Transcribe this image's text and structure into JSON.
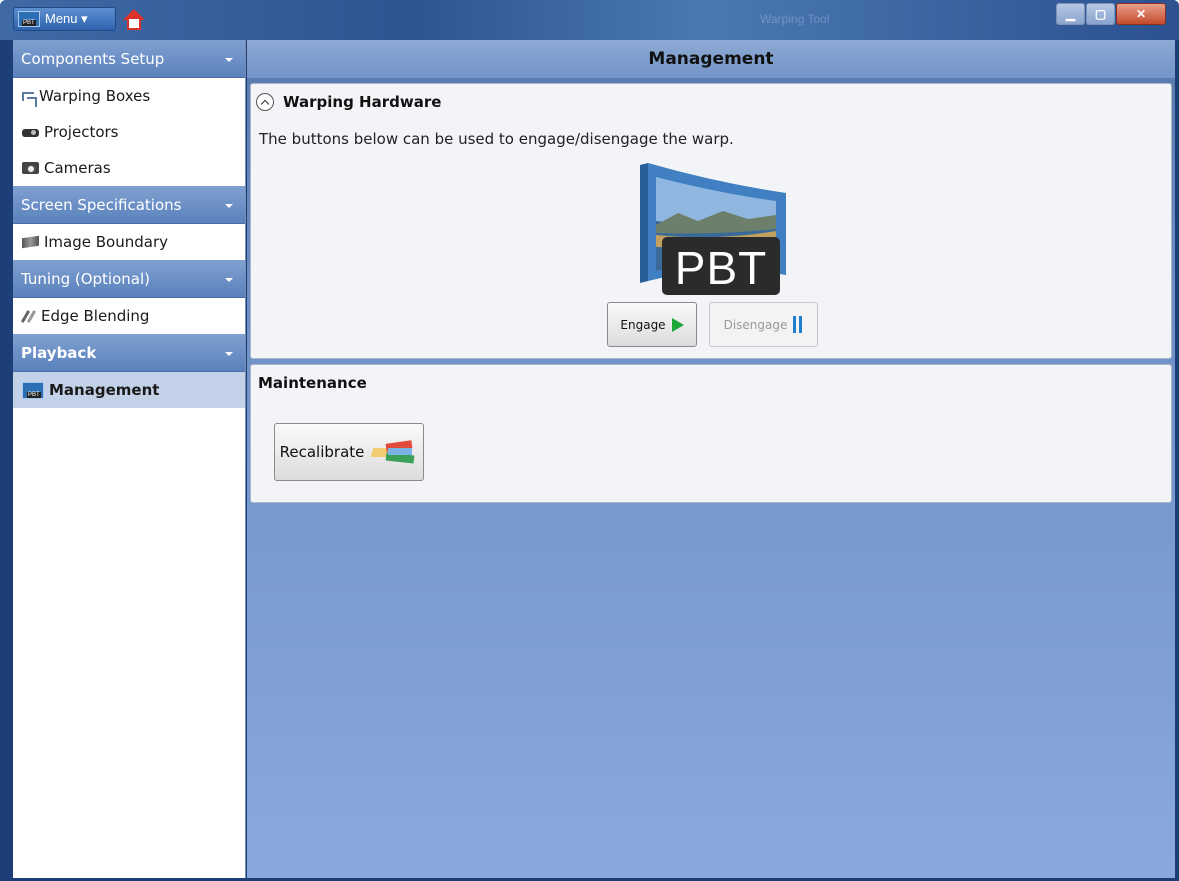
{
  "titlebar": {
    "menu_label": "Menu ▾",
    "window_title": "Warping Tool",
    "icons": [
      "pbt-app-icon",
      "home-icon",
      "minimize-icon",
      "maximize-icon",
      "close-icon"
    ]
  },
  "sidebar": {
    "sections": [
      {
        "label": "Components Setup",
        "items": [
          "Warping Boxes",
          "Projectors",
          "Cameras"
        ]
      },
      {
        "label": "Screen Specifications",
        "items": [
          "Image Boundary"
        ]
      },
      {
        "label": "Tuning (Optional)",
        "items": [
          "Edge Blending"
        ]
      },
      {
        "label": "Playback",
        "items": [
          "Management"
        ]
      }
    ],
    "active_item": "Management"
  },
  "main": {
    "header_title": "Management",
    "hardware": {
      "title": "Warping Hardware",
      "description": "The buttons below can be used to engage/disengage the warp.",
      "logo_text": "PBT",
      "engage_label": "Engage",
      "disengage_label": "Disengage"
    },
    "maintenance": {
      "title": "Maintenance",
      "recalibrate_label": "Recalibrate"
    }
  },
  "colors": {
    "accent_blue": "#5b82bd",
    "play_green": "#1fa83a",
    "pause_blue": "#1e7fd0",
    "close_red": "#c44a2c"
  }
}
